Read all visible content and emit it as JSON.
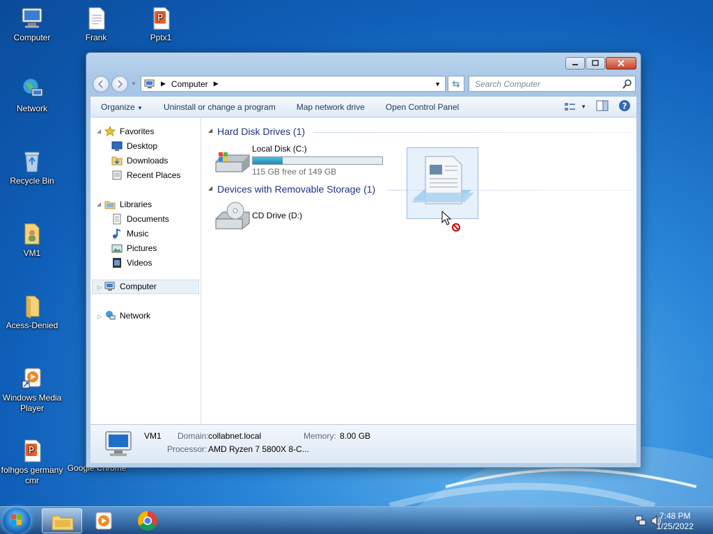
{
  "desktop": {
    "icons": [
      {
        "label": "Computer"
      },
      {
        "label": "Frank"
      },
      {
        "label": "Pptx1"
      },
      {
        "label": "Network"
      },
      {
        "label": "Recycle Bin"
      },
      {
        "label": "VM1"
      },
      {
        "label": "Acess-Denied"
      },
      {
        "label": "Windows Media Player"
      },
      {
        "label": "folhgos germany cmr"
      },
      {
        "label": "Google Chrome"
      }
    ]
  },
  "window": {
    "address": "Computer",
    "search_placeholder": "Search Computer",
    "toolbar": {
      "organize": "Organize",
      "uninstall": "Uninstall or change a program",
      "map_drive": "Map network drive",
      "control_panel": "Open Control Panel"
    },
    "sidebar": {
      "favorites": "Favorites",
      "desktop": "Desktop",
      "downloads": "Downloads",
      "recent": "Recent Places",
      "libraries": "Libraries",
      "documents": "Documents",
      "music": "Music",
      "pictures": "Pictures",
      "videos": "Videos",
      "computer": "Computer",
      "network": "Network"
    },
    "groups": {
      "hdd": "Hard Disk Drives (1)",
      "removable": "Devices with Removable Storage (1)"
    },
    "drives": {
      "c_name": "Local Disk (C:)",
      "c_free": "115 GB free of 149 GB",
      "c_used_fraction": 0.23,
      "d_name": "CD Drive (D:)"
    },
    "details": {
      "name": "VM1",
      "domain_label": "Domain:",
      "domain_value": "collabnet.local",
      "memory_label": "Memory:",
      "memory_value": "8.00 GB",
      "processor_label": "Processor:",
      "processor_value": "AMD Ryzen 7 5800X 8-C..."
    }
  },
  "taskbar": {
    "time": "7:48 PM",
    "date": "1/25/2022"
  },
  "colors": {
    "accent": "#1e3287",
    "progress": "#2ba3c7"
  }
}
